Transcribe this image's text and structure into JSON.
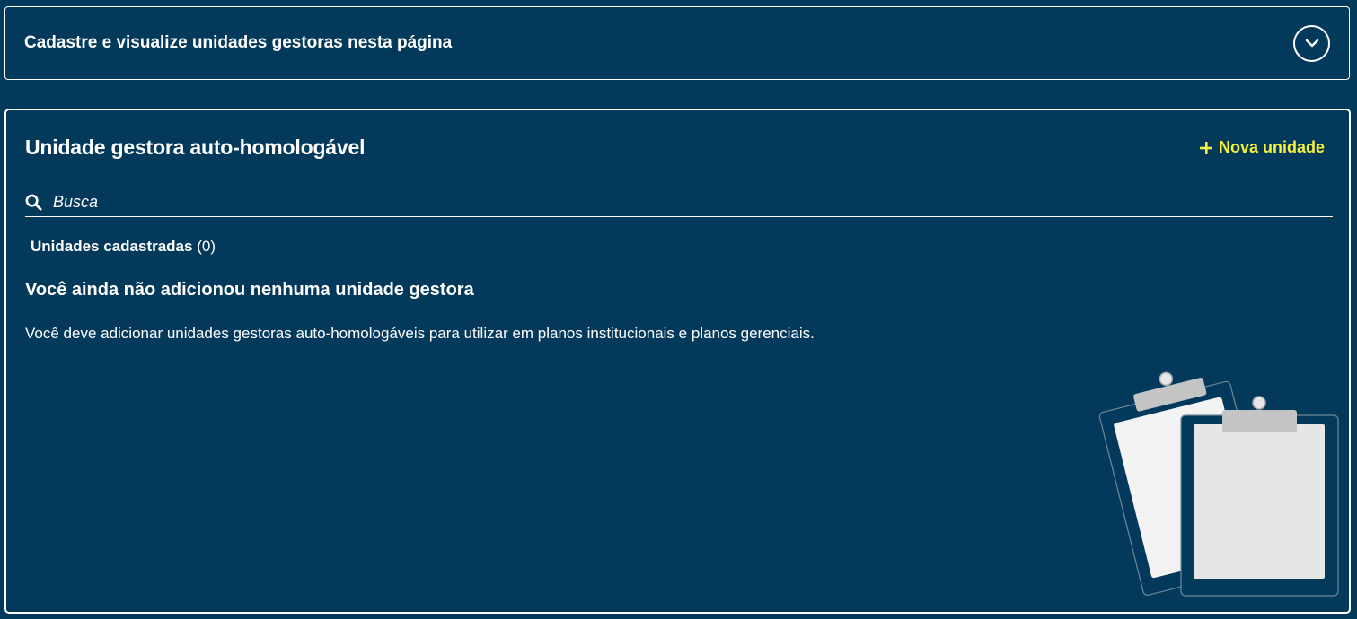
{
  "accordion": {
    "title": "Cadastre e visualize unidades gestoras nesta página",
    "toggle_icon": "chevron-down-icon"
  },
  "card": {
    "title": "Unidade gestora auto-homologável",
    "new_button": {
      "icon": "plus-icon",
      "label": "Nova unidade"
    },
    "search": {
      "icon": "search-icon",
      "placeholder": "Busca",
      "value": ""
    },
    "count": {
      "label": "Unidades cadastradas",
      "value": "(0)"
    },
    "empty_state": {
      "title": "Você ainda não adicionou nenhuma unidade gestora",
      "description": "Você deve adicionar unidades gestoras auto-homologáveis para utilizar em planos institucionais e planos gerenciais.",
      "illustration": "clipboards-illustration"
    }
  },
  "colors": {
    "background": "#033a5c",
    "text": "#ffffff",
    "accent": "#f6f03a"
  }
}
